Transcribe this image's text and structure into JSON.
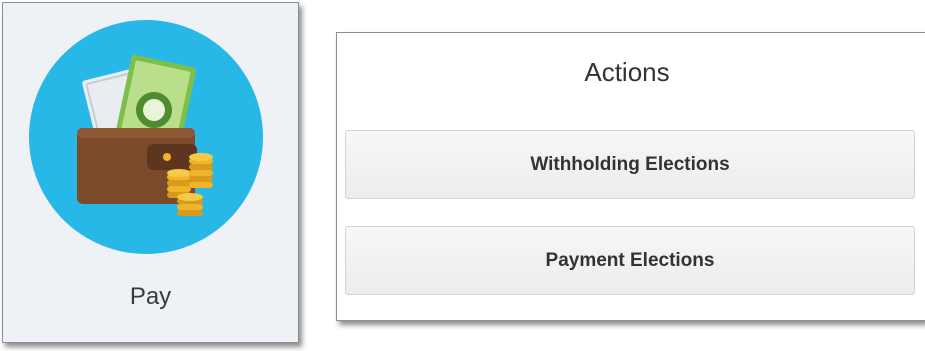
{
  "pay_tile": {
    "label": "Pay",
    "icon": "wallet-money-icon"
  },
  "actions": {
    "title": "Actions",
    "buttons": [
      {
        "label": "Withholding Elections"
      },
      {
        "label": "Payment Elections"
      }
    ]
  },
  "colors": {
    "icon_circle": "#27b8e8",
    "tile_background": "#eef2f7",
    "wallet": "#7b4a2a",
    "cash": "#7cc04a",
    "coins": "#f0b429"
  }
}
